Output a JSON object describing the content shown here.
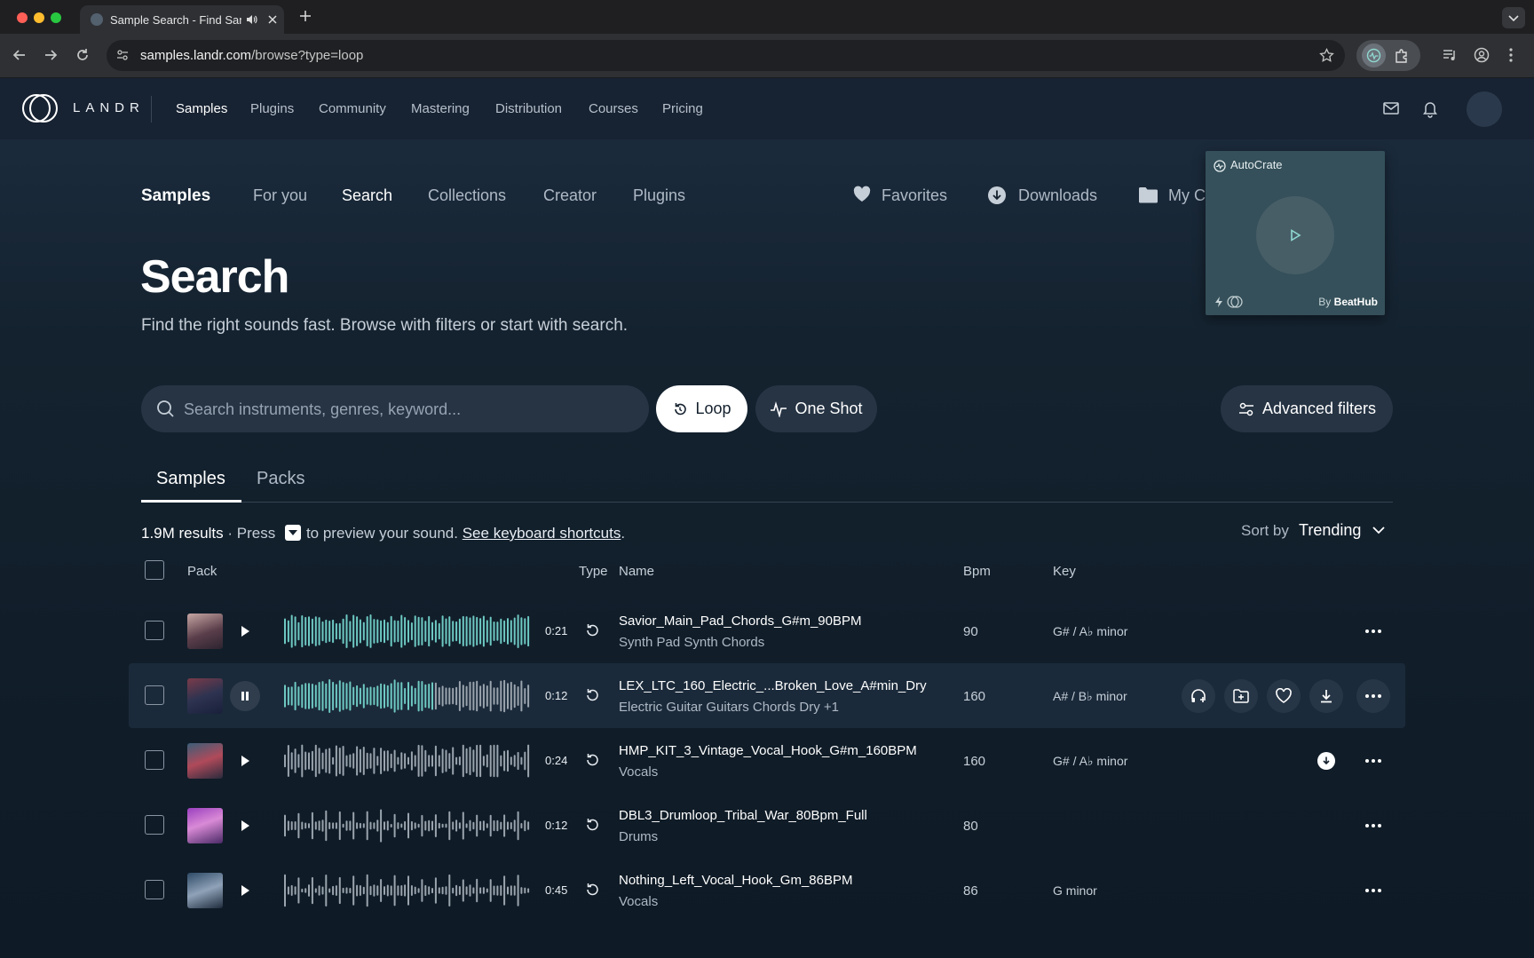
{
  "browser": {
    "tab_title": "Sample Search - Find Sam",
    "url_host": "samples.landr.com",
    "url_path": "/browse?type=loop"
  },
  "topnav": {
    "logo_text": "LANDR",
    "links": [
      "Samples",
      "Plugins",
      "Community",
      "Mastering",
      "Distribution",
      "Courses",
      "Pricing"
    ],
    "active": "Samples"
  },
  "subnav": {
    "brand": "Samples",
    "links": [
      "For you",
      "Search",
      "Collections",
      "Creator",
      "Plugins"
    ],
    "active": "Search",
    "favorites": "Favorites",
    "downloads": "Downloads",
    "my_collections": "My C"
  },
  "page": {
    "title": "Search",
    "subtitle": "Find the right sounds fast. Browse with filters or start with search."
  },
  "search": {
    "placeholder": "Search instruments, genres, keyword...",
    "value": "",
    "loop_label": "Loop",
    "oneshot_label": "One Shot",
    "advanced_label": "Advanced filters"
  },
  "result_tabs": {
    "samples": "Samples",
    "packs": "Packs",
    "active": "Samples"
  },
  "results": {
    "count": "1.9M results",
    "sep": "·",
    "press": "Press",
    "preview_text": "to preview your sound.",
    "shortcuts_link": "See keyboard shortcuts",
    "period": ".",
    "sort_label": "Sort by",
    "sort_value": "Trending"
  },
  "columns": {
    "pack": "Pack",
    "type": "Type",
    "name": "Name",
    "bpm": "Bpm",
    "key": "Key"
  },
  "rows": [
    {
      "duration": "0:21",
      "name": "Savior_Main_Pad_Chords_G#m_90BPM",
      "tags": "Synth Pad Synth Chords",
      "bpm": "90",
      "key": "G# / A♭ minor",
      "playing": false,
      "played_fraction": 1.0,
      "downloaded": false
    },
    {
      "duration": "0:12",
      "name": "LEX_LTC_160_Electric_...Broken_Love_A#min_Dry",
      "tags": "Electric Guitar Guitars Chords Dry +1",
      "bpm": "160",
      "key": "A# / B♭ minor",
      "playing": true,
      "played_fraction": 0.6,
      "downloaded": false
    },
    {
      "duration": "0:24",
      "name": "HMP_KIT_3_Vintage_Vocal_Hook_G#m_160BPM",
      "tags": "Vocals",
      "bpm": "160",
      "key": "G# / A♭ minor",
      "playing": false,
      "played_fraction": 0.0,
      "downloaded": true
    },
    {
      "duration": "0:12",
      "name": "DBL3_Drumloop_Tribal_War_80Bpm_Full",
      "tags": "Drums",
      "bpm": "80",
      "key": "",
      "playing": false,
      "played_fraction": 0.0,
      "downloaded": false
    },
    {
      "duration": "0:45",
      "name": "Nothing_Left_Vocal_Hook_Gm_86BPM",
      "tags": "Vocals",
      "bpm": "86",
      "key": "G minor",
      "playing": false,
      "played_fraction": 0.0,
      "downloaded": false
    }
  ],
  "popup": {
    "title": "AutoCrate",
    "by": "By",
    "by_brand": "BeatHub"
  },
  "colors": {
    "accent_waveform": "#6ec9c3",
    "waveform_unplayed": "#9aa4ae",
    "background": "#0f1a26"
  }
}
